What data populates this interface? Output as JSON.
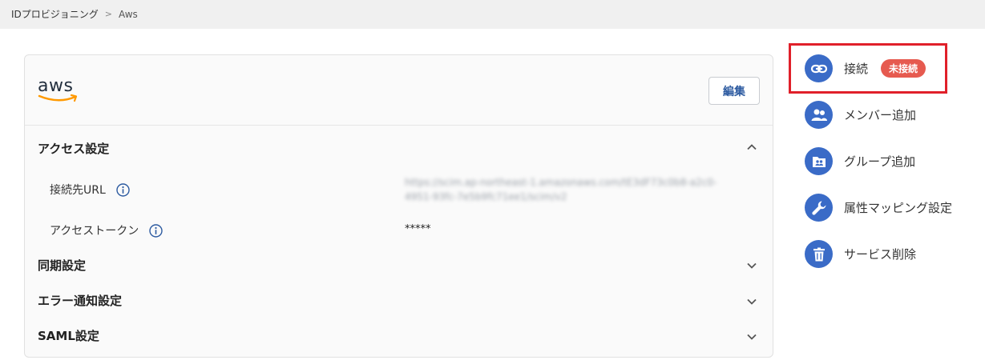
{
  "breadcrumb": {
    "parent": "IDプロビジョニング",
    "separator": ">",
    "current": "Aws"
  },
  "card": {
    "logo_text": "aws",
    "edit_label": "編集",
    "sections": {
      "access": {
        "title": "アクセス設定",
        "expanded": true,
        "url_label": "接続先URL",
        "url_value_line1": "https://scim.ap-northeast-1.amazonaws.com/tE3dF73c0b8-a2c0-",
        "url_value_line2": "4951-93fc-7e5b9fc71ee1/scim/v2",
        "token_label": "アクセストークン",
        "token_value": "*****"
      },
      "sync": {
        "title": "同期設定",
        "expanded": false
      },
      "error": {
        "title": "エラー通知設定",
        "expanded": false
      },
      "saml": {
        "title": "SAML設定",
        "expanded": false
      }
    }
  },
  "sidebar": {
    "connect": {
      "label": "接続",
      "badge": "未接続",
      "icon": "link-icon"
    },
    "add_member": {
      "label": "メンバー追加",
      "icon": "people-icon"
    },
    "add_group": {
      "label": "グループ追加",
      "icon": "group-folder-icon"
    },
    "attr_mapping": {
      "label": "属性マッピング設定",
      "icon": "wrench-icon"
    },
    "delete_service": {
      "label": "サービス削除",
      "icon": "trash-icon"
    }
  },
  "colors": {
    "accent": "#3a6bc7",
    "badge": "#e65a4f",
    "highlight": "#e0202a",
    "aws_orange": "#ff9900"
  }
}
